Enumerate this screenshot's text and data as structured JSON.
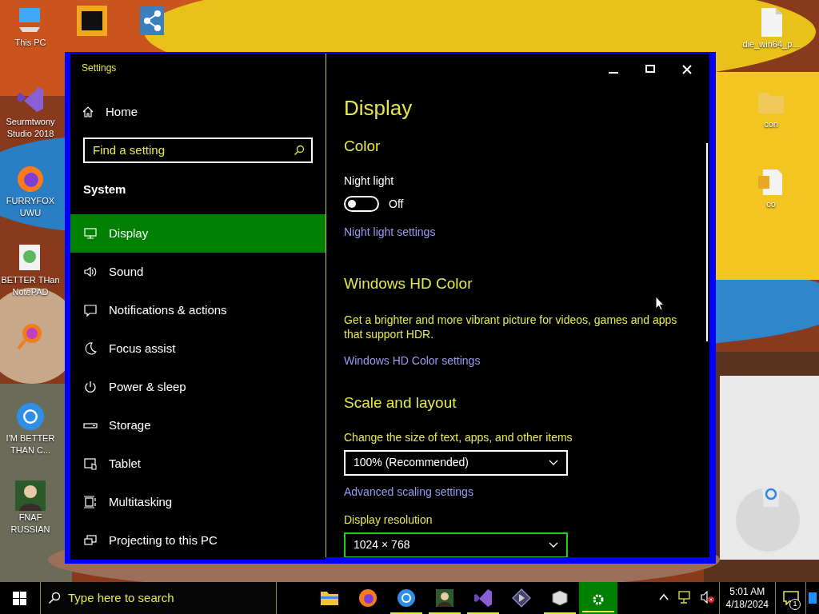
{
  "desktop": {
    "left_icons": [
      {
        "kind": "pc",
        "label": "This PC"
      },
      {
        "kind": "vs",
        "label": "Seurmtwony Studio 2018"
      },
      {
        "kind": "firefox",
        "label": "FURRYFOX UWU"
      },
      {
        "kind": "notepad",
        "label": "BETTER THan NotePAD"
      },
      {
        "kind": "magnifier"
      },
      {
        "kind": "chrome",
        "label": "I'M BETTER THAN C..."
      },
      {
        "kind": "avatar",
        "label": "FNAF RUSSIAN"
      }
    ],
    "top_icons": [
      {
        "kind": "de"
      },
      {
        "kind": "share"
      }
    ],
    "right_icons": [
      {
        "kind": "file",
        "label": "die_win64_p..."
      },
      {
        "kind": "folder",
        "label": "con"
      },
      {
        "kind": "zip",
        "label": "co"
      },
      {
        "kind": "bin"
      }
    ]
  },
  "window": {
    "title": "Settings"
  },
  "sidebar": {
    "home": "Home",
    "search": {
      "placeholder": "Find a setting"
    },
    "section": "System",
    "items": [
      {
        "label": "Display",
        "selected": true
      },
      {
        "label": "Sound",
        "selected": false
      },
      {
        "label": "Notifications & actions",
        "selected": false
      },
      {
        "label": "Focus assist",
        "selected": false
      },
      {
        "label": "Power & sleep",
        "selected": false
      },
      {
        "label": "Storage",
        "selected": false
      },
      {
        "label": "Tablet",
        "selected": false
      },
      {
        "label": "Multitasking",
        "selected": false
      },
      {
        "label": "Projecting to this PC",
        "selected": false
      }
    ]
  },
  "content": {
    "title": "Display",
    "sections": [
      {
        "heading": "Color",
        "items": [
          {
            "kind": "label",
            "text": "Night light"
          },
          {
            "kind": "toggle",
            "on": false,
            "text": "Off"
          },
          {
            "kind": "link",
            "text": "Night light settings"
          }
        ]
      },
      {
        "heading": "Windows HD Color",
        "items": [
          {
            "kind": "paragraph",
            "text": "Get a brighter and more vibrant picture for videos, games and apps that support HDR."
          },
          {
            "kind": "link",
            "text": "Windows HD Color settings"
          }
        ]
      },
      {
        "heading": "Scale and layout",
        "items": [
          {
            "kind": "caption",
            "text": "Change the size of text, apps, and other items"
          },
          {
            "kind": "dropdown",
            "value": "100% (Recommended)",
            "focused": false
          },
          {
            "kind": "link",
            "text": "Advanced scaling settings"
          },
          {
            "kind": "caption",
            "text": "Display resolution"
          },
          {
            "kind": "dropdown",
            "value": "1024 × 768",
            "focused": true
          }
        ]
      }
    ]
  },
  "taskbar": {
    "search": {
      "placeholder": "Type here to search"
    },
    "apps": [
      {
        "kind": "folder",
        "running": false,
        "selected": false
      },
      {
        "kind": "firefox",
        "running": false,
        "selected": false
      },
      {
        "kind": "chrome",
        "running": true,
        "selected": false
      },
      {
        "kind": "avatar",
        "running": true,
        "selected": false
      },
      {
        "kind": "vs",
        "running": true,
        "selected": false
      },
      {
        "kind": "diamond",
        "running": false,
        "selected": false
      },
      {
        "kind": "cube",
        "running": true,
        "selected": false
      },
      {
        "kind": "gear",
        "running": true,
        "selected": true
      }
    ],
    "time": "5:01 AM",
    "date": "4/18/2024",
    "notifications": "1"
  }
}
